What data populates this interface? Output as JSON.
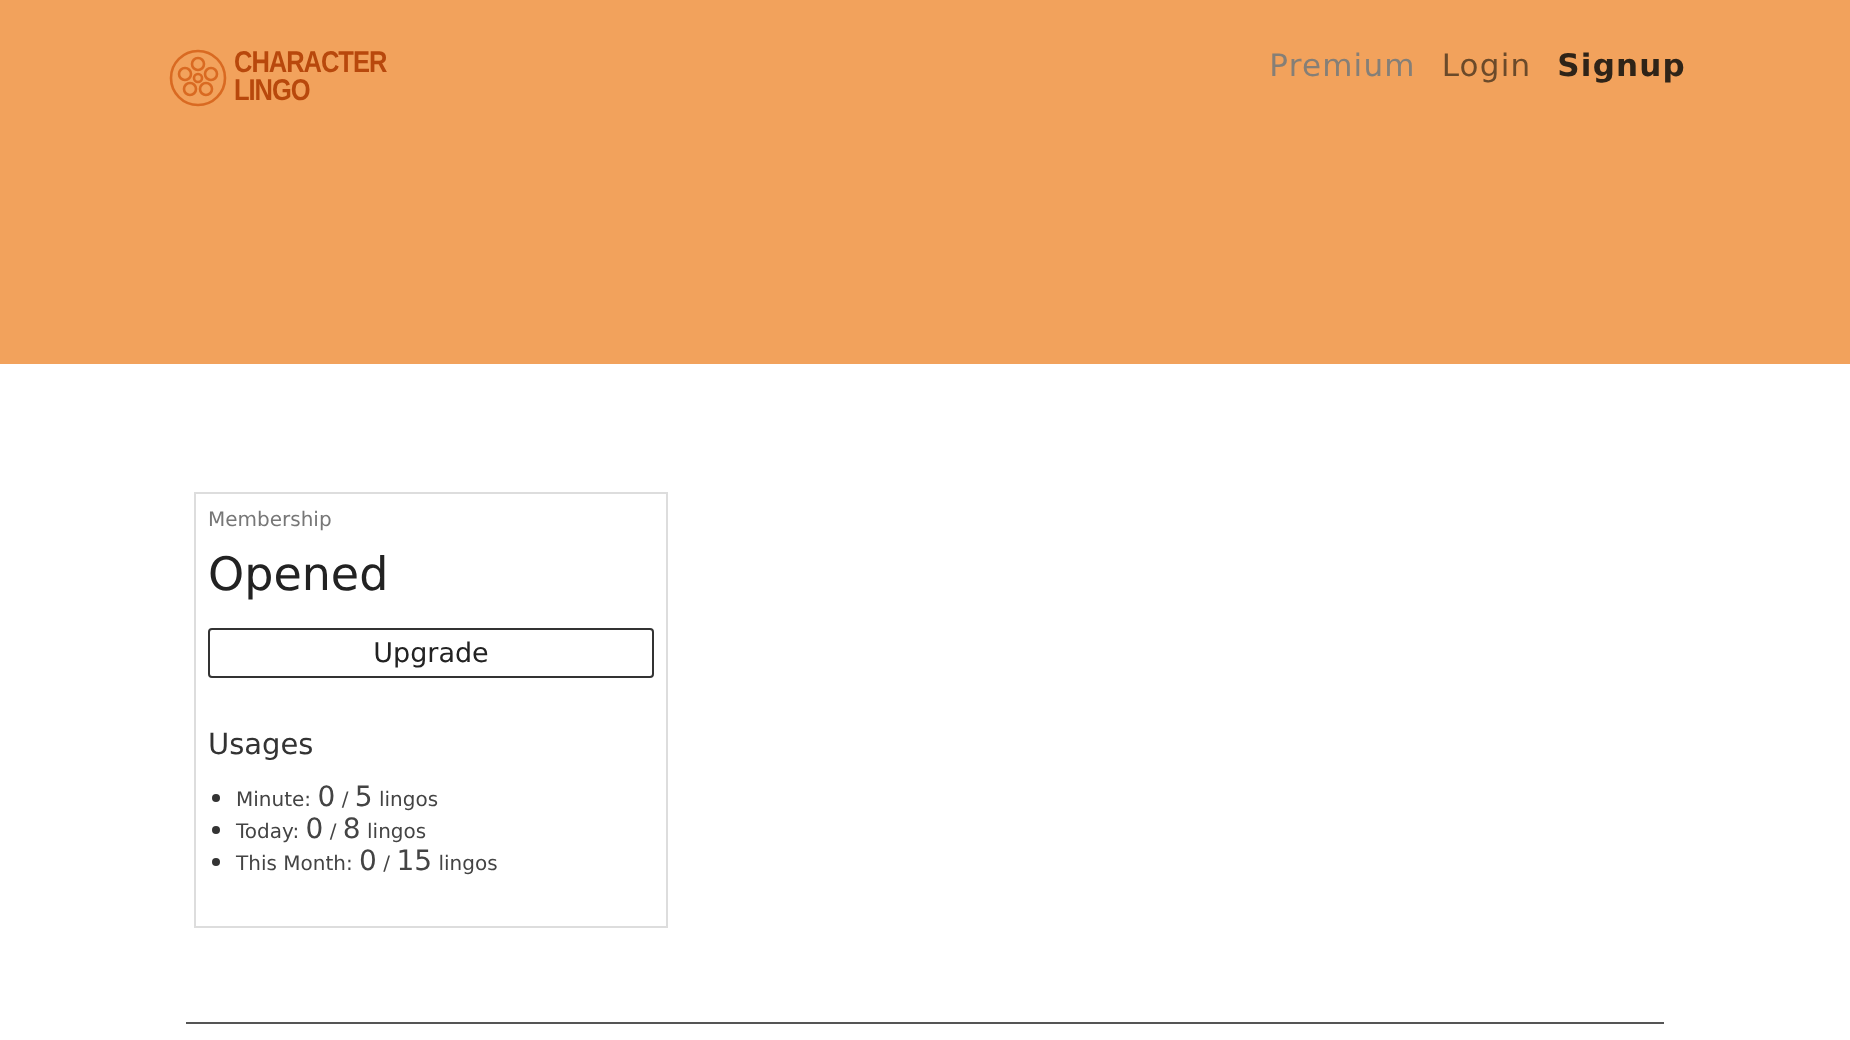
{
  "logo": {
    "lines": [
      "CHARACTER",
      "LINGO"
    ]
  },
  "nav": [
    {
      "label": "Premium",
      "kind": "muted"
    },
    {
      "label": "Login",
      "kind": "plain"
    },
    {
      "label": "Signup",
      "kind": "strong"
    }
  ],
  "membership": {
    "caption": "Membership",
    "status": "Opened",
    "button": "Upgrade",
    "usages_title": "Usages",
    "usages": [
      {
        "label": "Minute:",
        "used": "0",
        "sep": "/",
        "limit": "5",
        "unit": "lingos"
      },
      {
        "label": "Today:",
        "used": "0",
        "sep": "/",
        "limit": "8",
        "unit": "lingos"
      },
      {
        "label": "This Month:",
        "used": "0",
        "sep": "/",
        "limit": "15",
        "unit": "lingos"
      }
    ]
  }
}
